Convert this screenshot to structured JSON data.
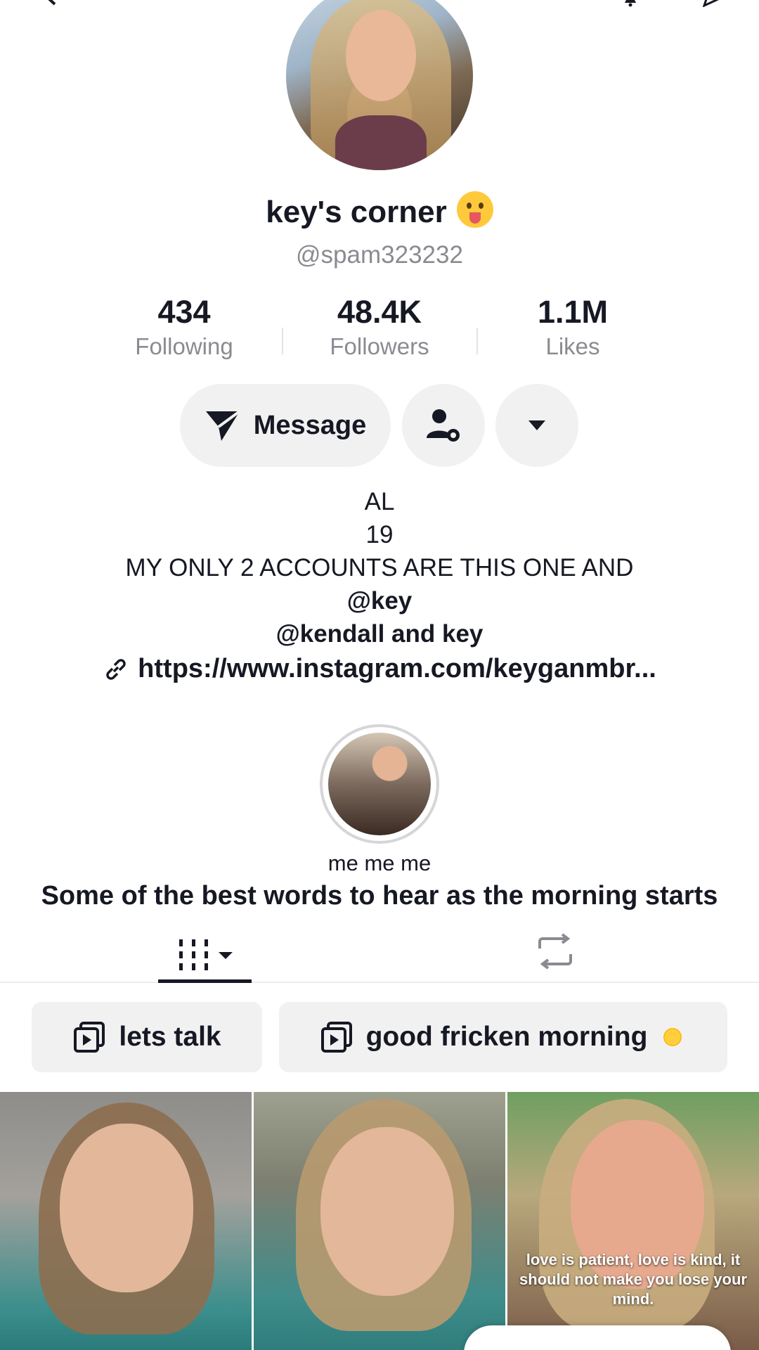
{
  "profile": {
    "display_name": "key's corner",
    "emoji_icon": "tongue-out-emoji",
    "handle": "@spam323232"
  },
  "stats": [
    {
      "value": "434",
      "label": "Following"
    },
    {
      "value": "48.4K",
      "label": "Followers"
    },
    {
      "value": "1.1M",
      "label": "Likes"
    }
  ],
  "actions": {
    "message_label": "Message"
  },
  "bio": {
    "lines": [
      "AL",
      "19",
      "MY ONLY 2 ACCOUNTS ARE THIS ONE AND"
    ],
    "mention_1": "@key",
    "mention_2": "@kendall and key",
    "link": "https://www.instagram.com/keyganmbr..."
  },
  "highlight": {
    "label": "me me me"
  },
  "caption": "Some of the best words to hear as the morning starts",
  "playlists": [
    {
      "label": "lets talk"
    },
    {
      "label": "good fricken morning"
    }
  ],
  "videos": [
    {
      "overlay_text": ""
    },
    {
      "overlay_text": ""
    },
    {
      "overlay_text": "love is patient, love is kind, it should not make you lose your mind."
    }
  ],
  "colors": {
    "text": "#161823",
    "secondary_text": "#8a8b91",
    "button_bg": "#f1f1f2"
  }
}
